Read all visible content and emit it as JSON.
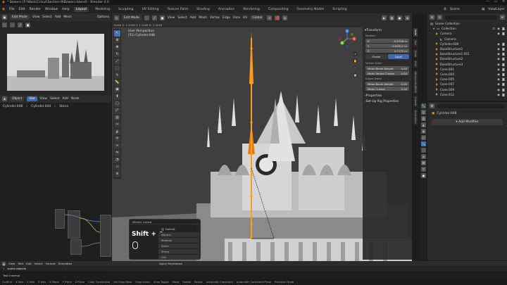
{
  "titlebar": {
    "title": "* Bowers [F:\\Work\\Cricut\\Section-9\\Bowers.blend] - Blender 4.0",
    "min": "—",
    "max": "☐",
    "close": "✕"
  },
  "menubar": {
    "items": [
      "File",
      "Edit",
      "Render",
      "Window",
      "Help"
    ],
    "workspaces": [
      "Layout",
      "Modeling",
      "Sculpting",
      "UV Editing",
      "Texture Paint",
      "Shading",
      "Animation",
      "Rendering",
      "Compositing",
      "Geometry Nodes",
      "Scripting"
    ],
    "scene": "Scene",
    "viewlayer": "ViewLayer"
  },
  "imgeditor": {
    "mode": "Edit Mode",
    "menu": [
      "View",
      "Select",
      "Add",
      "Mesh"
    ],
    "options": "Options"
  },
  "nodeeditor": {
    "mode": "Object",
    "menu": [
      "View",
      "Select",
      "Add",
      "Node"
    ],
    "slot": "Use",
    "breadcrumb": [
      "Cylinder.048",
      "Cylinder.044",
      "Stone"
    ]
  },
  "viewport": {
    "mode": "Edit Mode",
    "menu": [
      "View",
      "Select",
      "Add",
      "Mesh",
      "Vertex",
      "Edge",
      "Face",
      "UV"
    ],
    "orientation": "Global",
    "readout": "Scale X: 1.2049   Y: 1.2049   Z: 1.2049",
    "view_name": "User Perspective",
    "object_name": "(51) Cylinder.048",
    "gizmo_axes": {
      "x": "X",
      "y": "Y",
      "z": "Z"
    }
  },
  "npanel": {
    "transform": "Transform",
    "median": "Median:",
    "fields": [
      {
        "k": "X",
        "v": "-0.9706 m"
      },
      {
        "k": "Y",
        "v": "-0.52917 m"
      },
      {
        "k": "Z",
        "v": "0.7170 m"
      }
    ],
    "global": "Global",
    "local": "Local",
    "vertex_data": "Vertex Data:",
    "vertex_fields": [
      {
        "k": "Mean Bevel Weight",
        "v": "0.00"
      },
      {
        "k": "Mean Vertex Crease",
        "v": "0.00"
      }
    ],
    "edge_data": "Edges Data:",
    "edge_fields": [
      {
        "k": "Mean Bevel Weight",
        "v": "0.00"
      },
      {
        "k": "Mean Crease",
        "v": "0.00"
      }
    ],
    "properties": "Properties",
    "rig": "Set Up Rig Properties",
    "tabs": [
      "Item",
      "Tool",
      "View",
      "Edit",
      "MeasureIt-ARCH",
      "Create",
      "Animation"
    ]
  },
  "outliner": {
    "rows": [
      {
        "label": "Scene Collection",
        "indent": 0
      },
      {
        "label": "Collection",
        "indent": 1
      },
      {
        "label": "Camera",
        "indent": 2
      },
      {
        "label": "Camera",
        "indent": 3
      },
      {
        "label": "Cylinder.000",
        "indent": 2
      },
      {
        "label": "BaseStructure1",
        "indent": 2
      },
      {
        "label": "BaseStructure1.001",
        "indent": 2
      },
      {
        "label": "BaseStructure2",
        "indent": 2
      },
      {
        "label": "BaseStructure3",
        "indent": 2
      },
      {
        "label": "Cone.001",
        "indent": 2
      },
      {
        "label": "Cone.004",
        "indent": 2
      },
      {
        "label": "Cone.005",
        "indent": 2
      },
      {
        "label": "Cone.007",
        "indent": 2
      },
      {
        "label": "Cone.009",
        "indent": 2
      },
      {
        "label": "Cone.012",
        "indent": 2
      }
    ]
  },
  "props": {
    "object": "Cylinder.048",
    "add_modifier": "Add Modifier"
  },
  "popup": {
    "title": "Select Linked",
    "delimit": "Delimit",
    "options": [
      "Normal",
      "Material",
      "Seam",
      "Sharp",
      "UVs"
    ],
    "screencast": "Shift + ⊕"
  },
  "timeline": {
    "menu": [
      "View",
      "Text",
      "Edit",
      "Select",
      "Format",
      "Templates"
    ],
    "keyframe": "Apply Keyshapes"
  },
  "textpanel": {
    "line": "1",
    "code": "scene.objects",
    "name": "Text Internal"
  },
  "statusbar": {
    "items": [
      "Confirm",
      "X Axis",
      "Y Axis",
      "Z Axis",
      "X Plane",
      "Y Plane",
      "Z Plane",
      "Clear Constraints",
      "Set Snap Base",
      "Snap Invert",
      "Snap Toggle",
      "Move",
      "Rotate",
      "Resize",
      "Automatic Constraint",
      "Automatic Constraint Plane",
      "Precision Mode"
    ]
  }
}
